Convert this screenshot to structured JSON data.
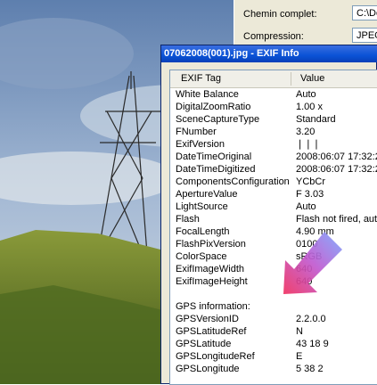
{
  "background_properties": {
    "rows": [
      {
        "label": "Chemin complet:",
        "value": "C:\\Do"
      },
      {
        "label": "Compression:",
        "value": "JPEG"
      }
    ]
  },
  "exif_window": {
    "title": "07062008(001).jpg - EXIF Info",
    "columns": {
      "tag": "EXIF Tag",
      "value": "Value"
    },
    "rows": [
      {
        "tag": "White Balance",
        "value": "Auto"
      },
      {
        "tag": "DigitalZoomRatio",
        "value": "1.00 x"
      },
      {
        "tag": "SceneCaptureType",
        "value": "Standard"
      },
      {
        "tag": "FNumber",
        "value": "3.20"
      },
      {
        "tag": "ExifVersion",
        "value": "❘❘❘"
      },
      {
        "tag": "DateTimeOriginal",
        "value": "2008:06:07 17:32:2"
      },
      {
        "tag": "DateTimeDigitized",
        "value": "2008:06:07 17:32:2"
      },
      {
        "tag": "ComponentsConfiguration",
        "value": "YCbCr"
      },
      {
        "tag": "ApertureValue",
        "value": "F 3.03"
      },
      {
        "tag": "LightSource",
        "value": "Auto"
      },
      {
        "tag": "Flash",
        "value": "Flash not fired, auto"
      },
      {
        "tag": "FocalLength",
        "value": "4.90 mm"
      },
      {
        "tag": "FlashPixVersion",
        "value": "0100"
      },
      {
        "tag": "ColorSpace",
        "value": "sRGB"
      },
      {
        "tag": "ExifImageWidth",
        "value": "640"
      },
      {
        "tag": "ExifImageHeight",
        "value": "640"
      },
      {
        "tag": "",
        "value": ""
      },
      {
        "tag": "GPS information:",
        "value": ""
      },
      {
        "tag": "GPSVersionID",
        "value": "2.2.0.0"
      },
      {
        "tag": "GPSLatitudeRef",
        "value": "N"
      },
      {
        "tag": "GPSLatitude",
        "value": "43 18 9"
      },
      {
        "tag": "GPSLongitudeRef",
        "value": "E"
      },
      {
        "tag": "GPSLongitude",
        "value": "5 38 2"
      }
    ]
  },
  "colors": {
    "titlebar": "#0a52d6",
    "window_bg": "#ece9d8",
    "arrow": "#e8305a"
  },
  "icons": [
    "pylon-photo",
    "pointer-arrow-icon"
  ]
}
